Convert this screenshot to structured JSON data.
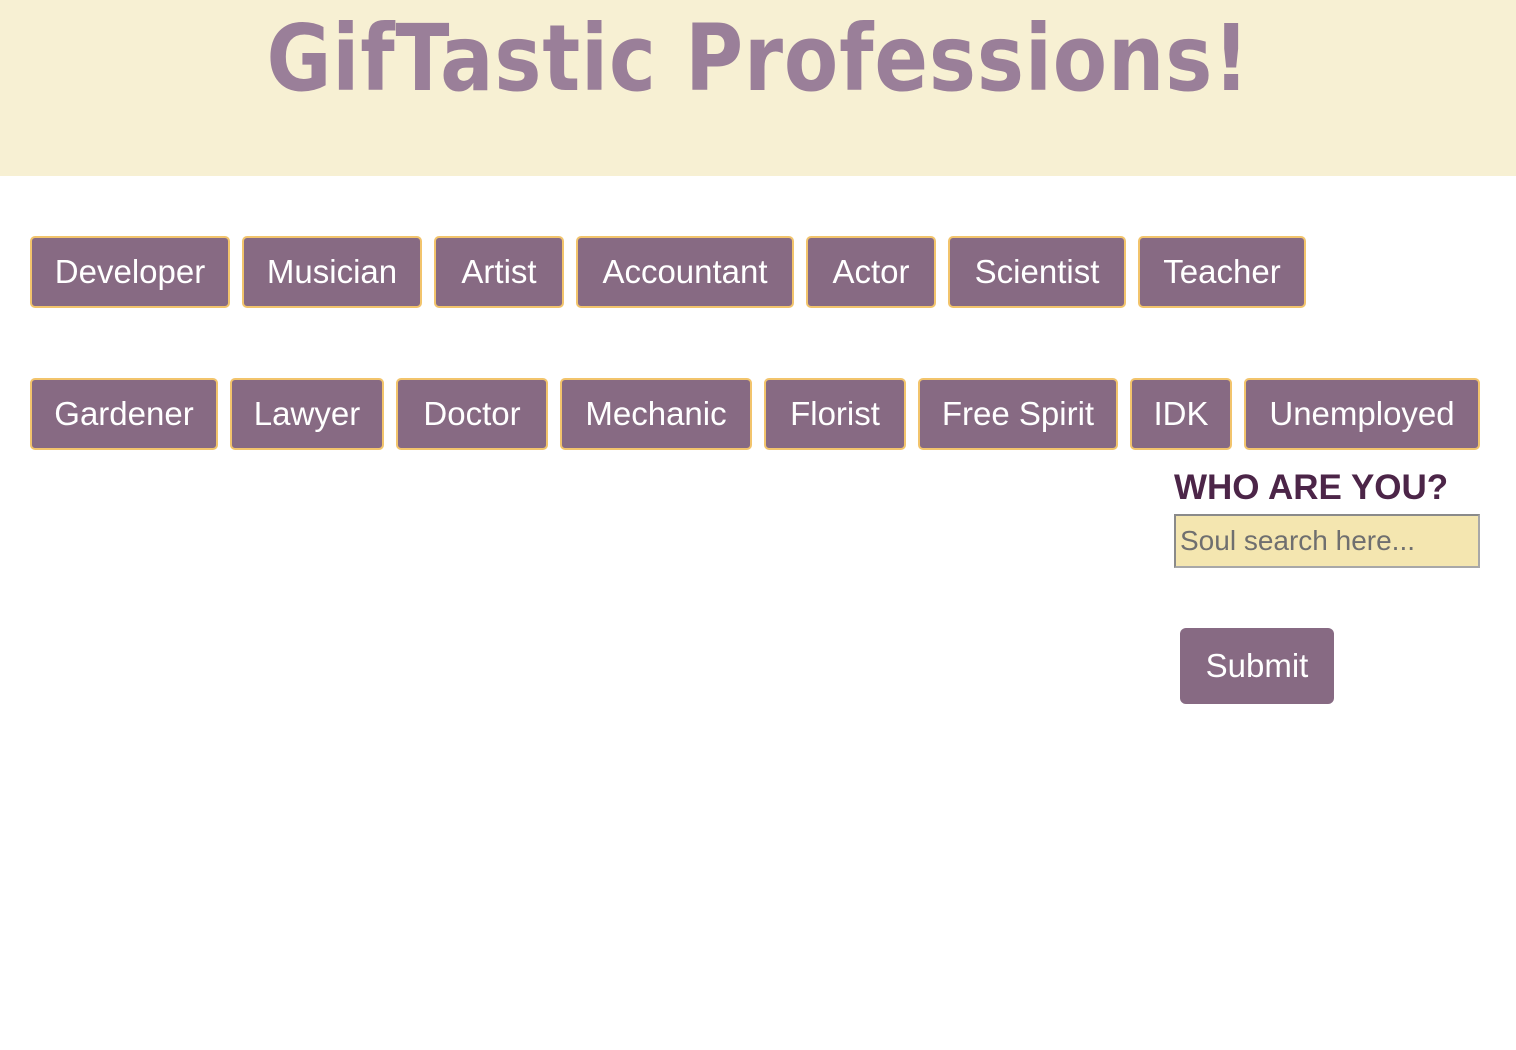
{
  "header": {
    "title": "GifTastic Professions!"
  },
  "buttons": {
    "row1": [
      "Developer",
      "Musician",
      "Artist",
      "Accountant",
      "Actor",
      "Scientist",
      "Teacher"
    ],
    "row2": [
      "Gardener",
      "Lawyer",
      "Doctor",
      "Mechanic",
      "Florist",
      "Free Spirit",
      "IDK",
      "Unemployed"
    ]
  },
  "search": {
    "label": "WHO ARE YOU?",
    "placeholder": "Soul search here...",
    "value": "",
    "submit_label": "Submit"
  },
  "colors": {
    "header_bg": "#f7f0d3",
    "title": "#9a7f99",
    "button_bg": "#876a83",
    "button_border": "#f2c46c",
    "label": "#4c2548",
    "input_bg": "#f4e6b0"
  }
}
